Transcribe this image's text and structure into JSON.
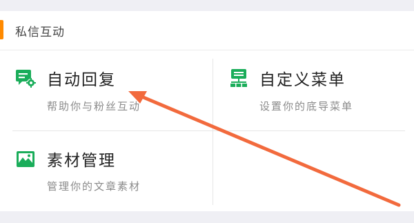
{
  "section": {
    "title": "私信互动",
    "accent_color": "#ff8a00"
  },
  "items": [
    {
      "title": "自动回复",
      "subtitle": "帮助你与粉丝互动",
      "icon": "auto-reply-icon"
    },
    {
      "title": "自定义菜单",
      "subtitle": "设置你的底导菜单",
      "icon": "custom-menu-icon"
    },
    {
      "title": "素材管理",
      "subtitle": "管理你的文章素材",
      "icon": "material-icon"
    }
  ],
  "icon_color": "#1aad5a",
  "annotation_color": "#f26a3d"
}
